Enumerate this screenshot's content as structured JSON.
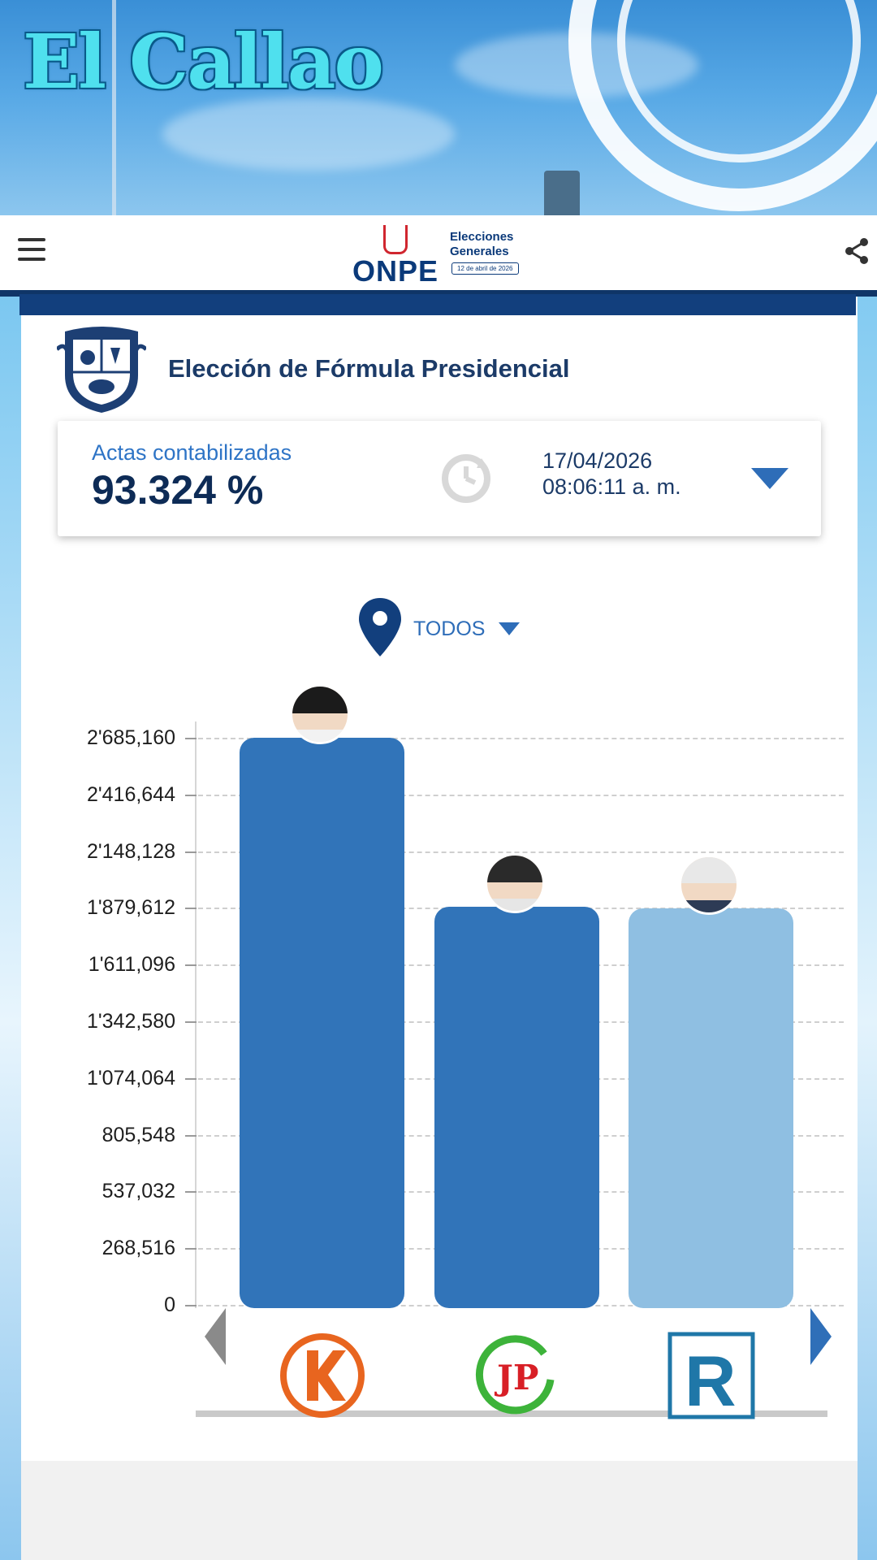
{
  "brand": {
    "name": "El Callao"
  },
  "header": {
    "menu_icon": "hamburger-menu-icon",
    "logo_word": "ONPE",
    "logo_title": "Elecciones Generales",
    "logo_date": "12 de abril de 2026",
    "share_icon": "share-icon"
  },
  "page": {
    "title": "Elección de Fórmula Presidencial"
  },
  "stats": {
    "label": "Actas contabilizadas",
    "value": "93.324 %",
    "date": "17/04/2026",
    "time": "08:06:11 a. m.",
    "clock_icon": "clock-refresh-icon",
    "toggle_icon": "chevron-down-icon"
  },
  "location": {
    "text": "TODOS",
    "icon": "location-pin-icon",
    "caret_icon": "caret-down-icon"
  },
  "colors": {
    "primary": "#3174b9",
    "light_bar": "#8fbfe2",
    "navy": "#0f3567",
    "k_orange": "#e8651f",
    "jp_green": "#3db33a",
    "jp_red": "#d81f26",
    "r_teal": "#1f77a8"
  },
  "chart_data": {
    "type": "bar",
    "yticks": [
      "2'685,160",
      "2'416,644",
      "2'148,128",
      "1'879,612",
      "1'611,096",
      "1'342,580",
      "1'074,064",
      "805,548",
      "537,032",
      "268,516",
      "0"
    ],
    "ylim": [
      0,
      2685160
    ],
    "categories": [
      "K",
      "JP",
      "R"
    ],
    "values": [
      2685160,
      1885000,
      1878000
    ],
    "bar_colors": [
      "#3174b9",
      "#3174b9",
      "#8fbfe2"
    ],
    "party_icons": [
      "fuerza-popular-k-logo",
      "juntos-por-el-peru-jp-logo",
      "renovacion-popular-r-logo"
    ],
    "nav_icons": [
      "chevron-left-icon",
      "chevron-right-icon"
    ]
  }
}
